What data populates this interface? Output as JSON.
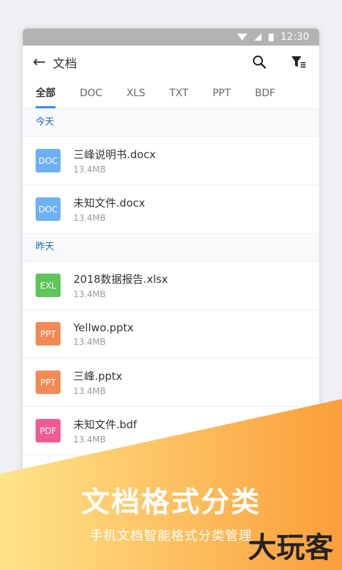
{
  "status": {
    "time": "12:30"
  },
  "appbar": {
    "back_icon": "arrow-left-icon",
    "title": "文档",
    "search_icon": "search-icon",
    "filter_icon": "filter-icon"
  },
  "tabs": [
    "全部",
    "DOC",
    "XLS",
    "TXT",
    "PPT",
    "BDF"
  ],
  "sections": [
    {
      "label": "今天",
      "files": [
        {
          "type": "DOC",
          "color": "#6cb1f3",
          "name": "三峰说明书.docx",
          "size": "13.4MB"
        },
        {
          "type": "DOC",
          "color": "#6cb1f3",
          "name": "未知文件.docx",
          "size": "13.4MB"
        }
      ]
    },
    {
      "label": "昨天",
      "files": [
        {
          "type": "EXL",
          "color": "#5fc45a",
          "name": "2018数据报告.xlsx",
          "size": "13.4MB"
        },
        {
          "type": "PPT",
          "color": "#f08b55",
          "name": "Yellwo.pptx",
          "size": "13.4MB"
        },
        {
          "type": "PPT",
          "color": "#f08b55",
          "name": "三峰.pptx",
          "size": "13.4MB"
        },
        {
          "type": "PDF",
          "color": "#ef5b94",
          "name": "未知文件.bdf",
          "size": "13.4MB"
        }
      ]
    }
  ],
  "banner": {
    "headline": "文档格式分类",
    "subline": "手机文档智能格式分类管理",
    "color_from": "#ffe48a",
    "color_to": "#fb9e3a"
  },
  "watermark": "大玩客"
}
